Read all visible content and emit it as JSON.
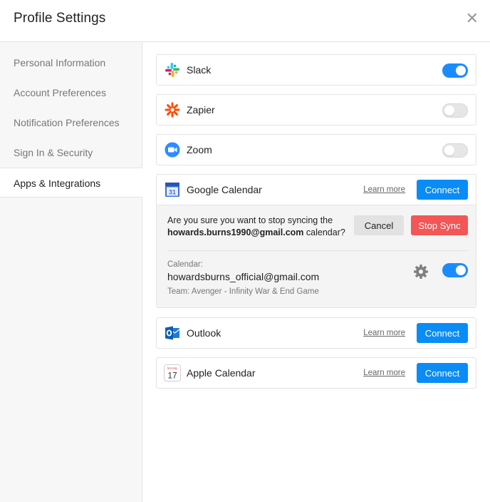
{
  "header": {
    "title": "Profile Settings",
    "close_glyph": "✕"
  },
  "sidebar": {
    "items": [
      {
        "label": "Personal Information"
      },
      {
        "label": "Account Preferences"
      },
      {
        "label": "Notification Preferences"
      },
      {
        "label": "Sign In & Security"
      },
      {
        "label": "Apps & Integrations",
        "active": true
      }
    ]
  },
  "apps": {
    "slack": {
      "name": "Slack",
      "icon": "slack-icon",
      "enabled": true
    },
    "zapier": {
      "name": "Zapier",
      "icon": "zapier-icon",
      "enabled": false
    },
    "zoom": {
      "name": "Zoom",
      "icon": "zoom-icon",
      "enabled": false
    },
    "google_calendar": {
      "name": "Google Calendar",
      "icon": "google-calendar-icon",
      "icon_text": "31",
      "learn_more": "Learn more",
      "connect_label": "Connect",
      "confirm": {
        "prefix": "Are you sure you want to stop syncing the",
        "email": "howards.burns1990@gmail.com",
        "suffix": "calendar?",
        "cancel_label": "Cancel",
        "stop_label": "Stop Sync"
      },
      "calendar": {
        "label": "Calendar:",
        "email": "howardsburns_official@gmail.com",
        "team": "Team: Avenger - Infinity War & End Game",
        "sync_enabled": true
      }
    },
    "outlook": {
      "name": "Outlook",
      "icon": "outlook-icon",
      "learn_more": "Learn more",
      "connect_label": "Connect"
    },
    "apple_calendar": {
      "name": "Apple Calendar",
      "icon": "apple-calendar-icon",
      "icon_month": "Monday",
      "icon_day": "17",
      "learn_more": "Learn more",
      "connect_label": "Connect"
    }
  },
  "colors": {
    "accent": "#0a8cf7",
    "danger": "#f25656",
    "toggle_on": "#1a8cff"
  }
}
